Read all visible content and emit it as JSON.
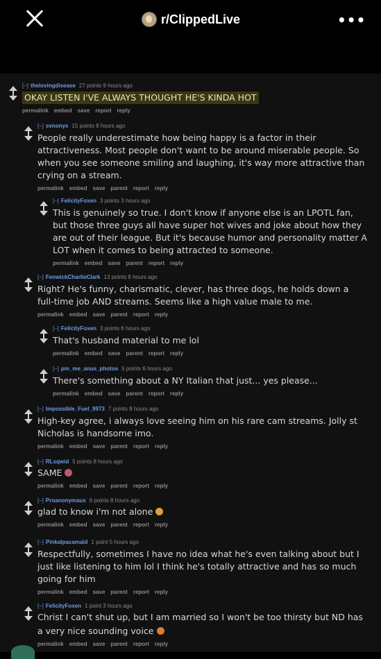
{
  "header": {
    "subreddit": "r/ClippedLive",
    "more": "•••"
  },
  "action_labels": [
    "permalink",
    "embed",
    "save",
    "parent",
    "report",
    "reply"
  ],
  "top_action_labels": [
    "permalink",
    "embed",
    "save",
    "report",
    "reply"
  ],
  "comments": [
    {
      "expand": "[–]",
      "author": "thelovingdisease",
      "meta": "27 points 9 hours ago",
      "text": "OKAY LISTEN I'VE ALWAYS THOUGHT HE'S KINDA HOT",
      "emoji": null
    },
    {
      "expand": "[–]",
      "author": "svnonyx",
      "meta": "15 points 8 hours ago",
      "text": "People really underestimate how being happy is a factor in their attractiveness. Most people don't want to be around miserable people. So when you see someone smiling and laughing, it's way more attractive than crying on a stream.",
      "emoji": null
    },
    {
      "expand": "[–]",
      "author": "FelicityFoxen",
      "meta": "3 points 3 hours ago",
      "text": "This is genuinely so true. I don't know if anyone else is an LPOTL fan, but those three guys all have super hot wives and joke about how they are out of their league. But it's because humor and personality matter A LOT when it comes to being attracted to someone.",
      "emoji": null
    },
    {
      "expand": "[–]",
      "author": "FenwickCharlieClark",
      "meta": "13 points 8 hours ago",
      "text": "Right? He's funny, charismatic, clever, has three dogs, he holds down a full-time job AND streams. Seems like a high value male to me.",
      "emoji": null
    },
    {
      "expand": "[–]",
      "author": "FelicityFoxen",
      "meta": "3 points 6 hours ago",
      "text": "That's husband material to me lol",
      "emoji": null
    },
    {
      "expand": "[–]",
      "author": "pm_me_anus_photos",
      "meta": "5 points 6 hours ago",
      "text": "There's something about a NY Italian that just... yes please...",
      "emoji": null
    },
    {
      "expand": "[–]",
      "author": "Impossible_Fuel_9973",
      "meta": "7 points 8 hours ago",
      "text": "High-key agree, i always love seeing him on his rare cam streams. Jolly st Nicholas is handsome imo.",
      "emoji": null
    },
    {
      "expand": "[–]",
      "author": "RLsqwid",
      "meta": "5 points 8 hours ago",
      "text": "SAME",
      "emoji": "#c4566e"
    },
    {
      "expand": "[–]",
      "author": "Proanonymaus",
      "meta": "6 points 8 hours ago",
      "text": "glad to know i'm not alone",
      "emoji": "#e0a133"
    },
    {
      "expand": "[–]",
      "author": "Pinkalpacamaid",
      "meta": "1 point 5 hours ago",
      "text": "Respectfully, sometimes I have no idea what he's even talking about but I just like listening to him lol I think he's totally attractive and has so much going for him",
      "emoji": null
    },
    {
      "expand": "[–]",
      "author": "FelicityFoxen",
      "meta": "1 point 3 hours ago",
      "text": "Christ I can't shut up, but I am married so I won't be too thirsty but ND has a very nice sounding voice",
      "emoji": "#e07a2a"
    }
  ]
}
